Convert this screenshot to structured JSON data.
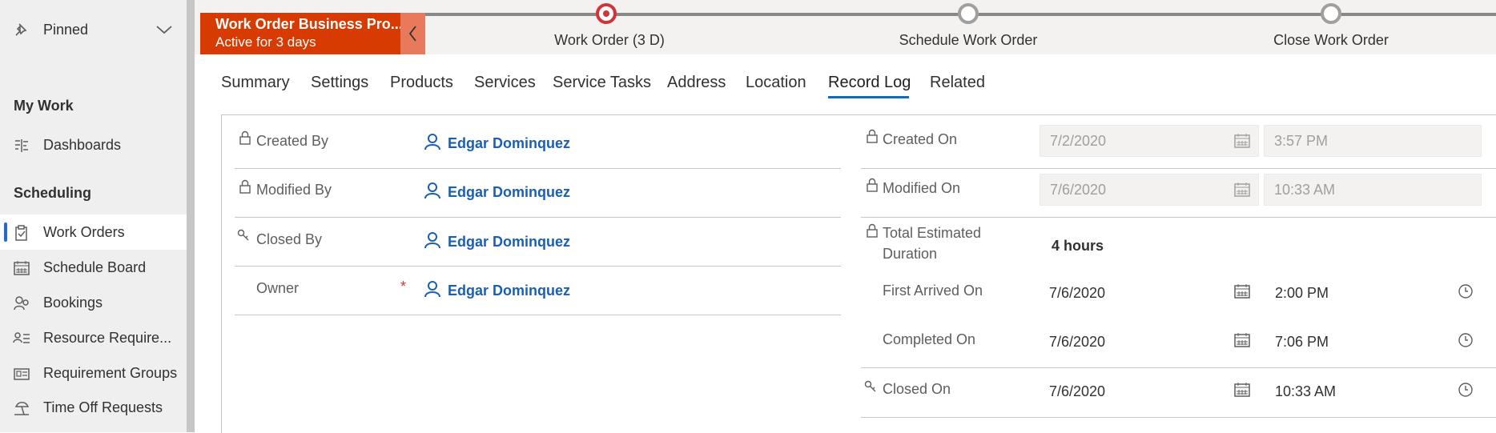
{
  "sidebar": {
    "pinned_label": "Pinned",
    "my_work_heading": "My Work",
    "dashboards_label": "Dashboards",
    "scheduling_heading": "Scheduling",
    "items": [
      {
        "label": "Work Orders",
        "icon": "clipboard-icon",
        "active": true
      },
      {
        "label": "Schedule Board",
        "icon": "calendar-grid-icon"
      },
      {
        "label": "Bookings",
        "icon": "people-icon"
      },
      {
        "label": "Resource Require...",
        "icon": "person-list-icon"
      },
      {
        "label": "Requirement Groups",
        "icon": "id-card-icon"
      },
      {
        "label": "Time Off Requests",
        "icon": "beach-icon"
      }
    ]
  },
  "bpf": {
    "process_name": "Work Order Business Pro...",
    "active_for": "Active for 3 days",
    "stages": [
      {
        "label": "Work Order  (3 D)",
        "state": "active"
      },
      {
        "label": "Schedule Work Order",
        "state": "pending"
      },
      {
        "label": "Close Work Order",
        "state": "pending"
      }
    ],
    "accent_color": "#d83b01"
  },
  "tabs": [
    "Summary",
    "Settings",
    "Products",
    "Services",
    "Service Tasks",
    "Address",
    "Location",
    "Record Log",
    "Related"
  ],
  "active_tab": "Record Log",
  "left_fields": {
    "created_by": {
      "label": "Created By",
      "value": "Edgar Dominquez"
    },
    "modified_by": {
      "label": "Modified By",
      "value": "Edgar Dominquez"
    },
    "closed_by": {
      "label": "Closed By",
      "value": "Edgar Dominquez"
    },
    "owner": {
      "label": "Owner",
      "required_mark": "*",
      "value": "Edgar Dominquez"
    }
  },
  "right_fields": {
    "created_on": {
      "label": "Created On",
      "date": "7/2/2020",
      "time": "3:57 PM"
    },
    "modified_on": {
      "label": "Modified On",
      "date": "7/6/2020",
      "time": "10:33 AM"
    },
    "total_estimated_duration": {
      "label_line1": "Total Estimated",
      "label_line2": "Duration",
      "value": "4 hours"
    },
    "first_arrived_on": {
      "label": "First Arrived On",
      "date": "7/6/2020",
      "time": "2:00 PM"
    },
    "completed_on": {
      "label": "Completed On",
      "date": "7/6/2020",
      "time": "7:06 PM"
    },
    "closed_on": {
      "label": "Closed On",
      "date": "7/6/2020",
      "time": "10:33 AM"
    }
  }
}
